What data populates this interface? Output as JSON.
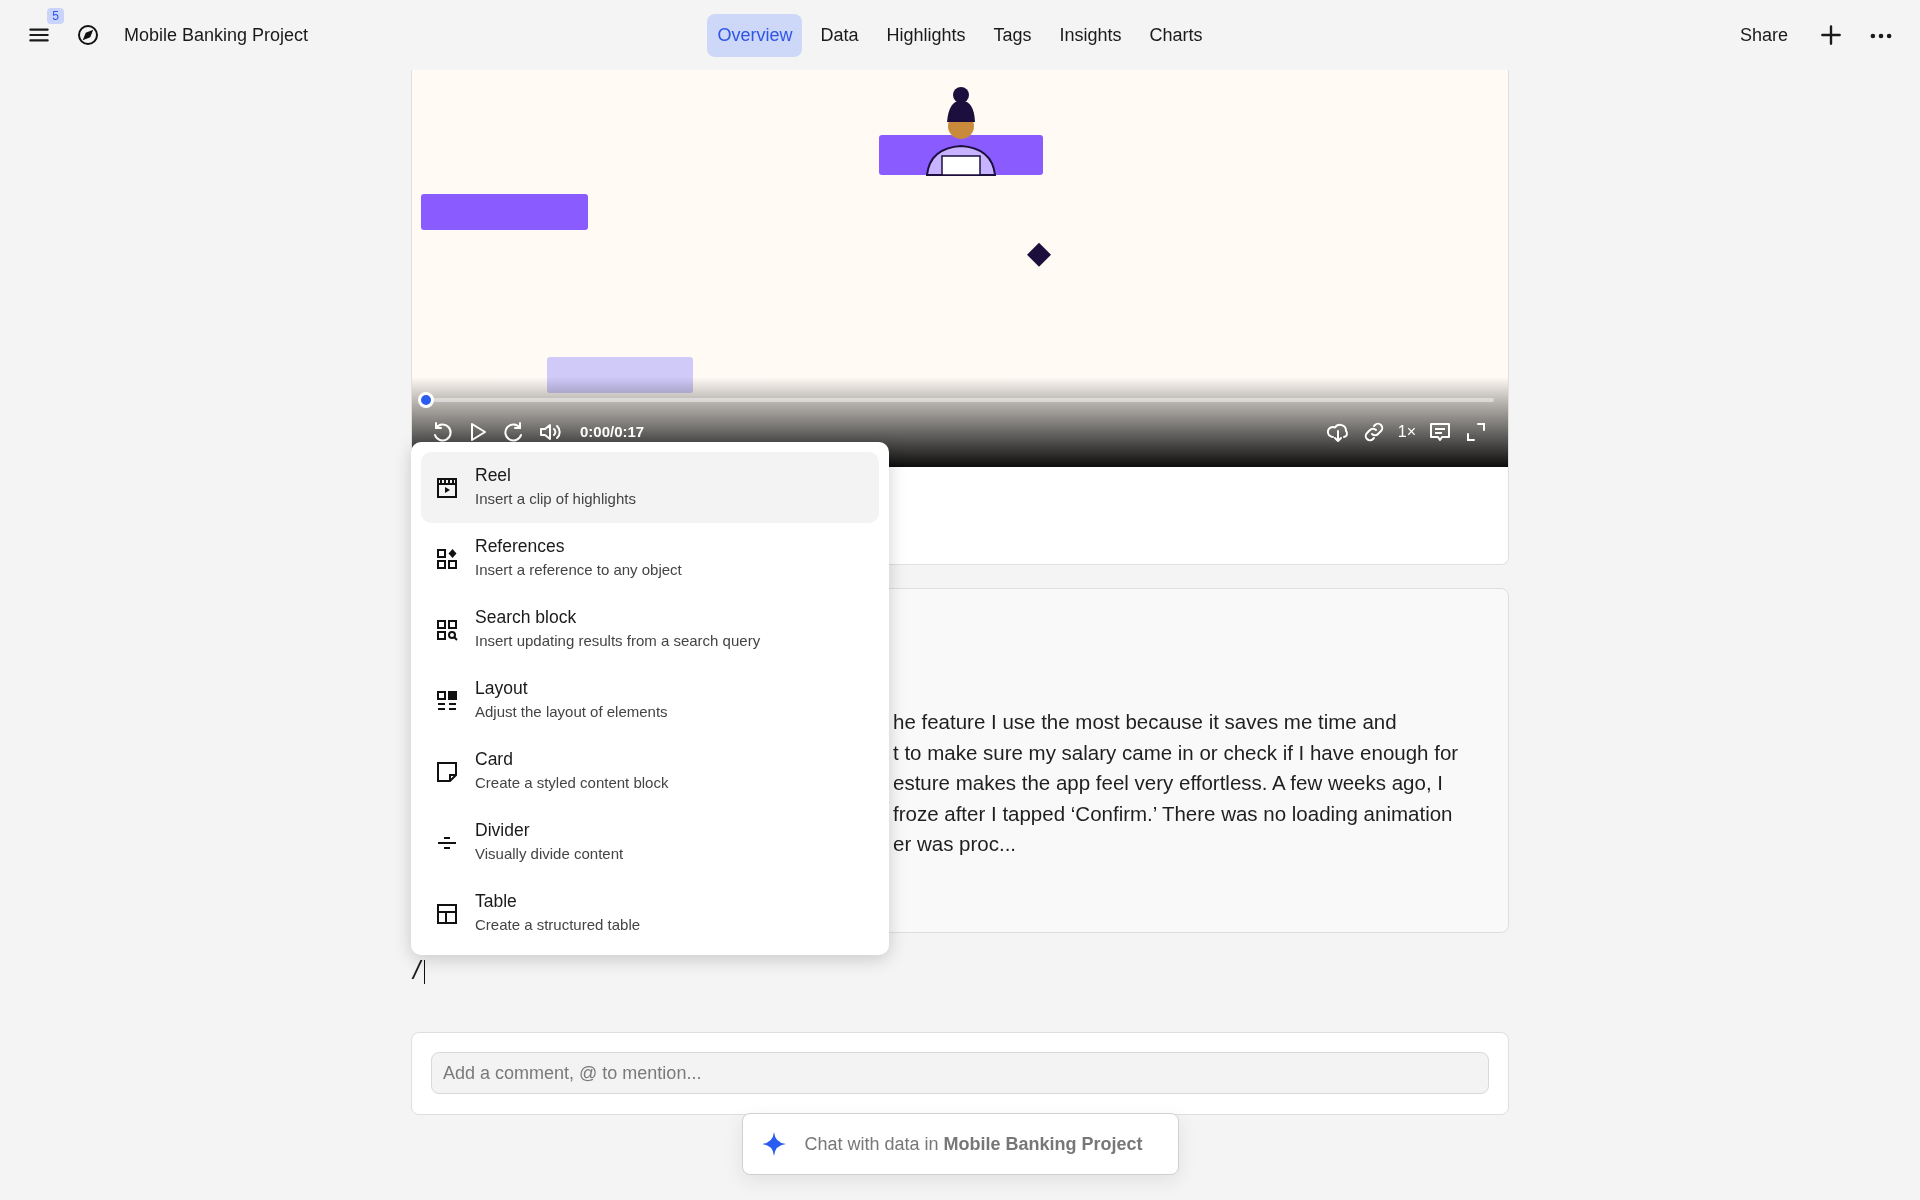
{
  "topbar": {
    "badge": "5",
    "project": "Mobile Banking Project",
    "share": "Share",
    "tabs": [
      {
        "label": "Overview",
        "selected": true
      },
      {
        "label": "Data",
        "selected": false
      },
      {
        "label": "Highlights",
        "selected": false
      },
      {
        "label": "Tags",
        "selected": false
      },
      {
        "label": "Insights",
        "selected": false
      },
      {
        "label": "Charts",
        "selected": false
      }
    ]
  },
  "video": {
    "progress": {
      "level": 0
    },
    "time": "0:00/0:17",
    "speed": "1×"
  },
  "transcript": {
    "lines": [
      "he feature I use the most because it saves me time and",
      "t to make sure my salary came in or check if I have enough for",
      "esture makes the app feel very effortless. A few weeks ago, I",
      "froze after I tapped ‘Confirm.’ There was no loading animation",
      "er was proc..."
    ]
  },
  "slash_input": "/",
  "insert_menu": {
    "items": [
      {
        "kind": "reel",
        "title": "Reel",
        "description": "Insert a clip of highlights",
        "selected": true
      },
      {
        "kind": "references",
        "title": "References",
        "description": "Insert a reference to any object",
        "selected": false
      },
      {
        "kind": "search",
        "title": "Search block",
        "description": "Insert updating results from a search query",
        "selected": false
      },
      {
        "kind": "layout",
        "title": "Layout",
        "description": "Adjust the layout of elements",
        "selected": false
      },
      {
        "kind": "card",
        "title": "Card",
        "description": "Create a styled content block",
        "selected": false
      },
      {
        "kind": "divider",
        "title": "Divider",
        "description": "Visually divide content",
        "selected": false
      },
      {
        "kind": "table",
        "title": "Table",
        "description": "Create a structured table",
        "selected": false
      }
    ]
  },
  "comment": {
    "placeholder": "Add a comment, @ to mention..."
  },
  "chat": {
    "text": "Chat with data in **Mobile Banking Project**"
  }
}
